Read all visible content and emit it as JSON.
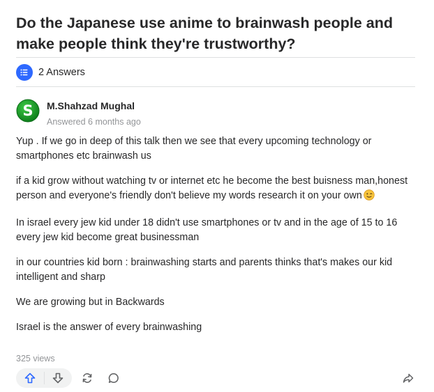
{
  "question": {
    "title": "Do the Japanese use anime to brainwash people and make people think they're trustworthy?"
  },
  "answers": {
    "count_label": "2 Answers",
    "icon": "list-icon"
  },
  "answer": {
    "author": {
      "name": "M.Shahzad Mughal",
      "avatar_letter": "S",
      "avatar_color": "#1a9a2a"
    },
    "answered_label": "Answered 6 months ago",
    "paragraphs": [
      "Yup . If we go in deep of this talk then we see that every upcoming technology or smartphones etc brainwash us",
      "if a kid grow without watching tv or internet etc he become the best buisness man,honest person and everyone's friendly don't believe my words research it on your own",
      "In israel every jew kid under 18 didn't use smartphones or tv and in the age of 15 to 16 every jew kid become great businessman",
      "in our countries kid born : brainwashing starts and parents thinks that's makes our kid intelligent and sharp",
      "We are growing but in Backwards",
      "Israel is the answer of every brainwashing"
    ],
    "views_label": "325 views"
  },
  "actions": {
    "upvote_icon": "upvote-arrow-icon",
    "downvote_icon": "downvote-arrow-icon",
    "share_icon": "reshare-icon",
    "comment_icon": "comment-icon",
    "forward_icon": "share-arrow-icon"
  },
  "colors": {
    "accent": "#2e69ff",
    "text": "#282829",
    "muted": "#939598",
    "divider": "#dee0e1"
  }
}
